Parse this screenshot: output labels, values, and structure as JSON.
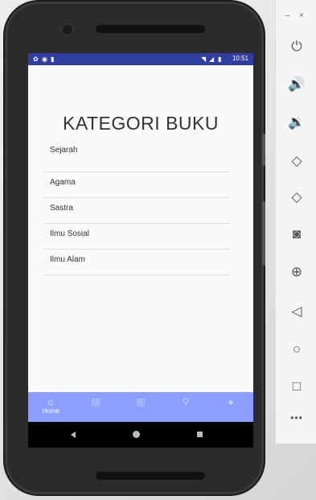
{
  "status_bar": {
    "left_icons": [
      "settings-icon",
      "circle-icon",
      "sd-card-icon"
    ],
    "right_icons": [
      "wifi-icon",
      "signal-icon",
      "battery-icon"
    ],
    "time": "10:51",
    "background": "#303f9f"
  },
  "page": {
    "title": "KATEGORI BUKU"
  },
  "categories": [
    {
      "label": "Sejarah"
    },
    {
      "label": "Agama"
    },
    {
      "label": "Sastra"
    },
    {
      "label": "Ilmu Sosial"
    },
    {
      "label": "Ilmu Alam"
    }
  ],
  "bottom_nav": {
    "background": "#8c9eff",
    "items": [
      {
        "icon": "home-icon",
        "label": "Home",
        "active": true
      },
      {
        "icon": "book-icon",
        "label": ""
      },
      {
        "icon": "library-icon",
        "label": ""
      },
      {
        "icon": "search-icon",
        "label": ""
      },
      {
        "icon": "account-icon",
        "label": ""
      }
    ]
  },
  "system_nav": {
    "icons": [
      "back-icon",
      "home-circle-icon",
      "recents-icon"
    ]
  },
  "emulator_toolbar": {
    "window_controls": [
      "minimize-icon",
      "close-icon"
    ],
    "buttons": [
      "power-icon",
      "volume-up-icon",
      "volume-down-icon",
      "rotate-left-icon",
      "rotate-right-icon",
      "camera-icon",
      "zoom-in-icon",
      "back-icon",
      "home-icon",
      "overview-icon",
      "more-icon"
    ]
  }
}
